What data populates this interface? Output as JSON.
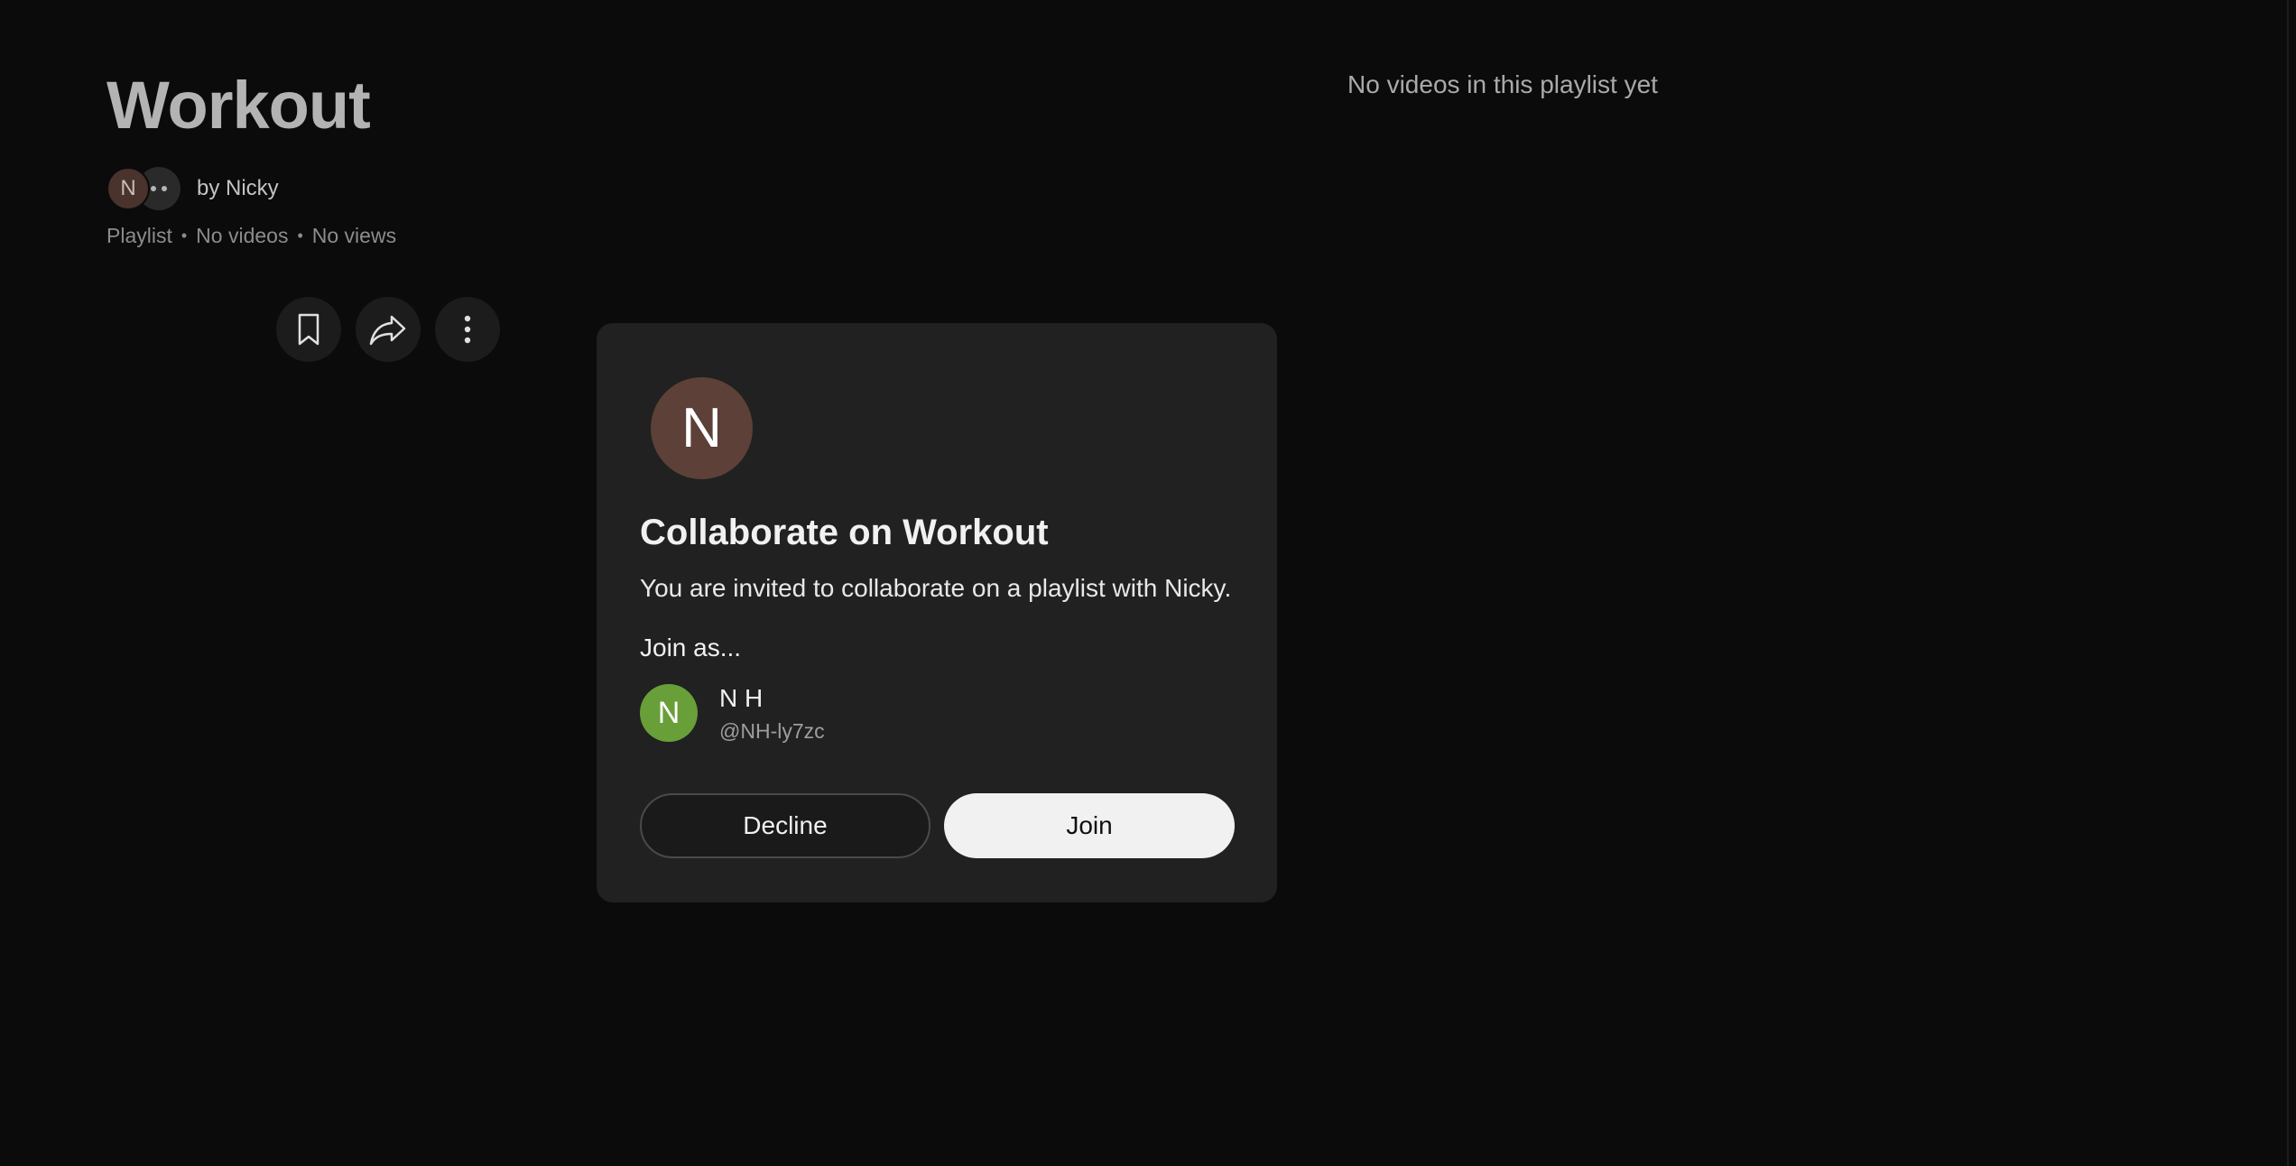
{
  "playlist": {
    "title": "Workout",
    "owner_avatar_letter": "N",
    "owner_text": "by Nicky",
    "meta": {
      "type": "Playlist",
      "videos": "No videos",
      "views": "No views",
      "separator": "•"
    },
    "actions": {
      "save_icon": "bookmark-icon",
      "share_icon": "share-icon",
      "more_icon": "more-vert-icon"
    },
    "empty_message": "No videos in this playlist yet"
  },
  "dialog": {
    "avatar_letter": "N",
    "title": "Collaborate on Workout",
    "body": "You are invited to collaborate on a playlist with Nicky.",
    "join_as_label": "Join as...",
    "account": {
      "avatar_letter": "N",
      "name": "N H",
      "handle": "@NH-ly7zc"
    },
    "decline_label": "Decline",
    "join_label": "Join"
  },
  "colors": {
    "background": "#0b0b0b",
    "dialog_background": "#212121",
    "owner_avatar": "#5d4037",
    "account_avatar": "#689f38",
    "primary_button": "#f1f1f1"
  }
}
